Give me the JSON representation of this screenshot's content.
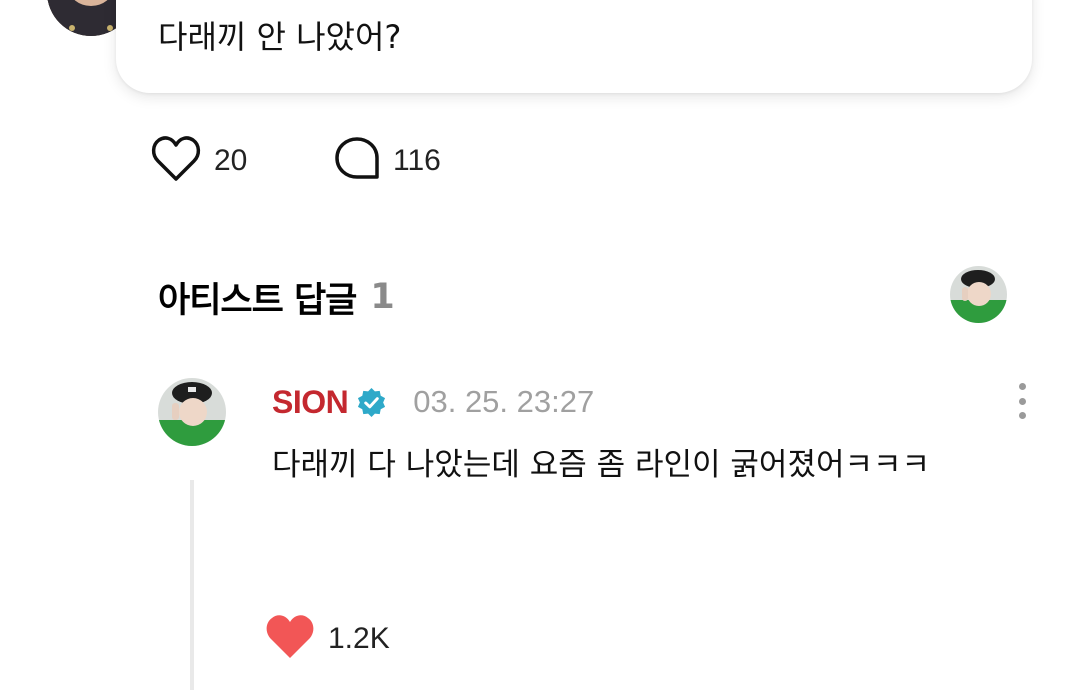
{
  "post": {
    "text": "다래끼 안 나았어?",
    "likes": "20",
    "comments": "116"
  },
  "artist_replies": {
    "title": "아티스트 답글",
    "count": "1"
  },
  "reply": {
    "author": "SION",
    "verified": true,
    "timestamp": "03. 25. 23:27",
    "text": "다래끼 다 나았는데 요즘 좀 라인이 굵어졌어ㅋㅋㅋ",
    "likes": "1.2K"
  },
  "colors": {
    "author_name": "#c4282f",
    "verified_badge": "#2ea9c9",
    "liked_heart": "#f25656",
    "secondary_text": "#a0a0a0"
  },
  "icons": {
    "like": "heart-outline-icon",
    "comment": "speech-bubble-icon",
    "verified": "verified-badge-icon",
    "more": "kebab-menu-icon",
    "liked": "heart-filled-icon"
  }
}
